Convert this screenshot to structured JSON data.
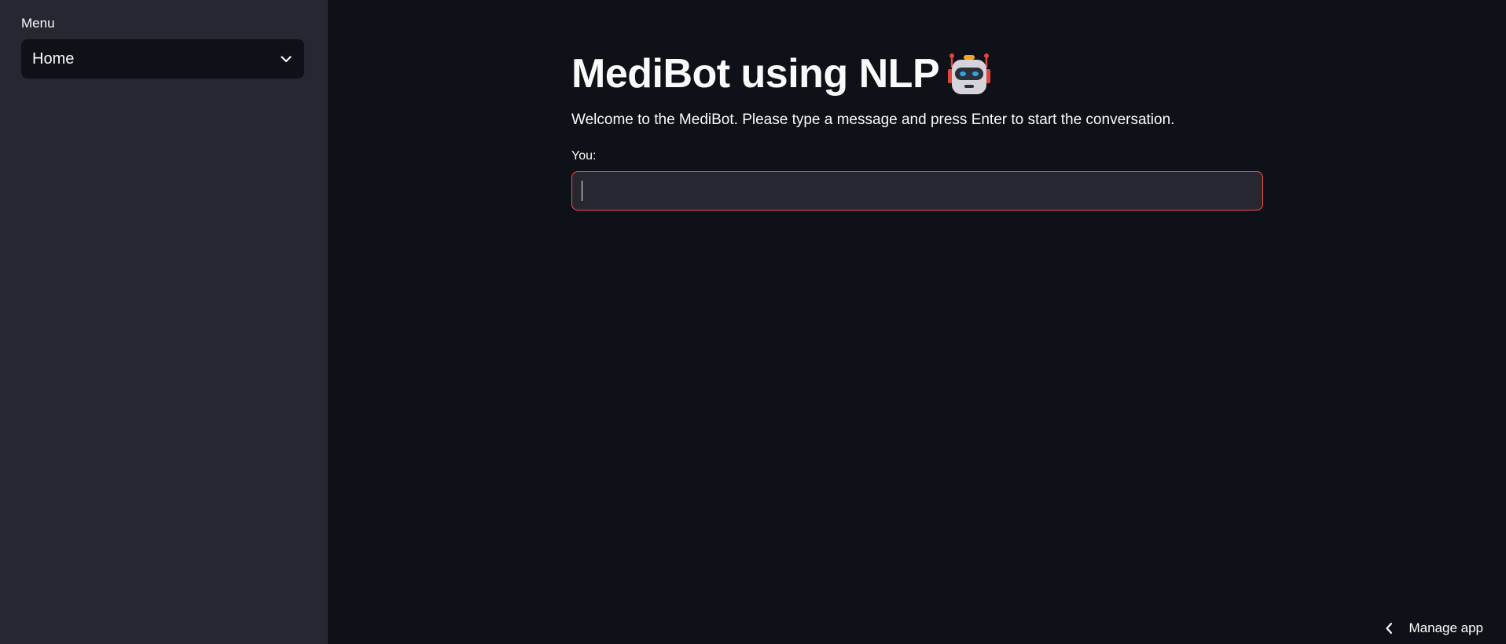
{
  "sidebar": {
    "label": "Menu",
    "select": {
      "value": "Home",
      "icon": "chevron-down-icon"
    }
  },
  "main": {
    "title": "MediBot using NLP",
    "title_icon": "robot-icon",
    "welcome": "Welcome to the MediBot. Please type a message and press Enter to start the conversation.",
    "input": {
      "label": "You:",
      "value": "",
      "placeholder": ""
    }
  },
  "footer": {
    "manage_label": "Manage app",
    "manage_icon": "chevron-left-icon"
  },
  "colors": {
    "background": "#0e1117",
    "sidebar": "#262730",
    "input_bg": "#262730",
    "focus_border": "#ff4b4b",
    "text": "#fafafa"
  }
}
